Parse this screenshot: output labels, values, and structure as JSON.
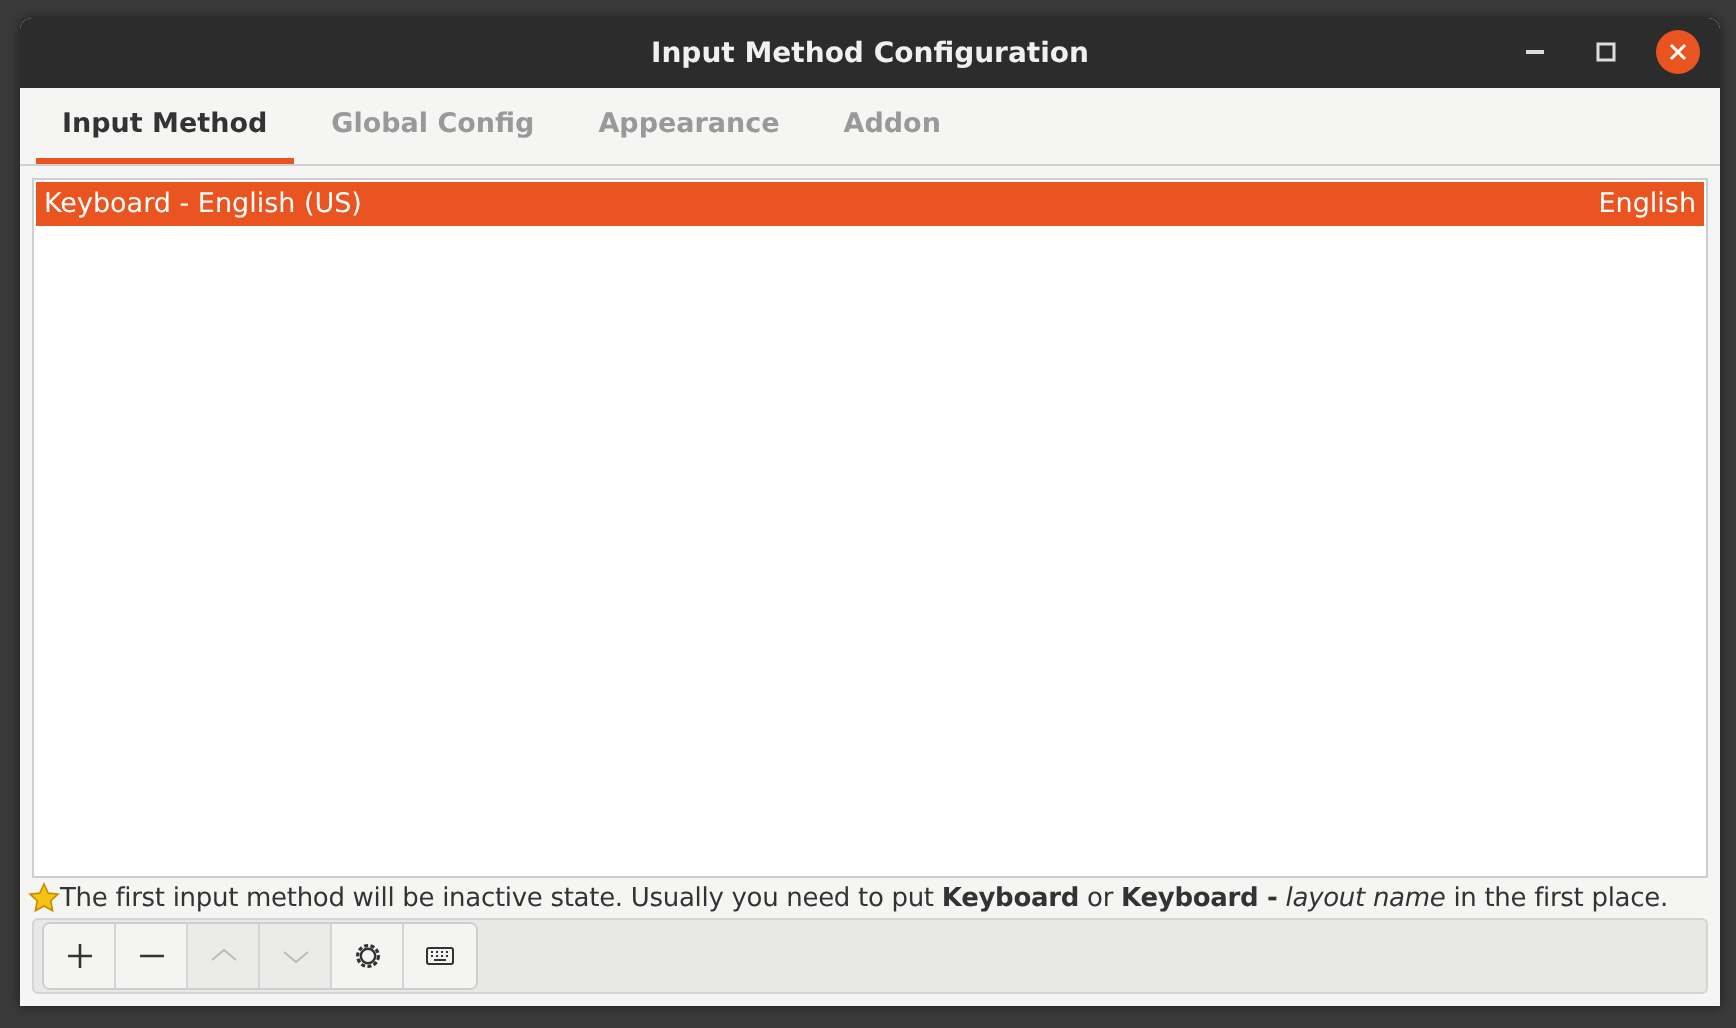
{
  "window": {
    "title": "Input Method Configuration"
  },
  "tabs": [
    {
      "label": "Input Method",
      "selected": true
    },
    {
      "label": "Global Config",
      "selected": false
    },
    {
      "label": "Appearance",
      "selected": false
    },
    {
      "label": "Addon",
      "selected": false
    }
  ],
  "input_methods": [
    {
      "name": "Keyboard - English (US)",
      "language": "English",
      "selected": true
    }
  ],
  "hint": "The first input method will be inactive state. Usually you need to put **Keyboard** or **Keyboard -** *layout name* in the first place.",
  "toolbar": [
    {
      "kind": "add",
      "disabled": false
    },
    {
      "kind": "remove",
      "disabled": false
    },
    {
      "kind": "up",
      "disabled": true
    },
    {
      "kind": "down",
      "disabled": true
    },
    {
      "kind": "configure",
      "disabled": false
    },
    {
      "kind": "keyboard",
      "disabled": false
    }
  ]
}
